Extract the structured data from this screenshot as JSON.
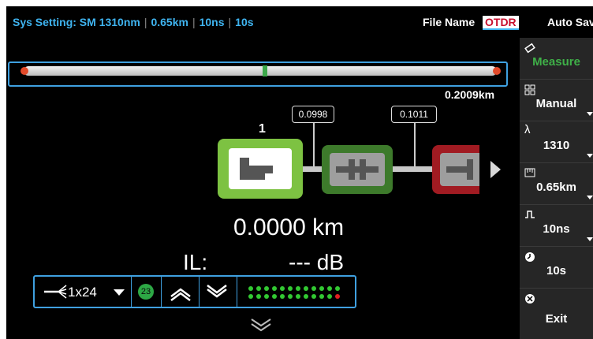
{
  "header": {
    "sys_setting_label": "Sys Setting: SM 1310nm",
    "sys_distance": "0.65km",
    "sys_pulse": "10ns",
    "sys_time": "10s",
    "file_name_label": "File Name",
    "file_name_value": "OTDR",
    "auto_save_label": "Auto Save"
  },
  "trace": {
    "total_distance": "0.2009km",
    "cursor_position_fraction": 0.51
  },
  "event_map": {
    "current_event_number": "1",
    "segments": [
      {
        "loss_label": "0.0998"
      },
      {
        "loss_label": "0.1011"
      }
    ],
    "node_colors": [
      "#7dc242",
      "#3d7a2b",
      "#a11b22"
    ],
    "distance": "0.0000 km",
    "il_label": "IL:",
    "il_value": "--- dB"
  },
  "toolbar": {
    "port_label": "1x24",
    "port_badge": "23",
    "led_count": 24,
    "led_active_color": "#32c832",
    "led_alert_color": "#e02020"
  },
  "sidebar": {
    "items": [
      {
        "label": "Measure",
        "icon": "eraser-icon",
        "active": true
      },
      {
        "label": "Manual",
        "icon": "grid-icon"
      },
      {
        "label": "1310",
        "icon": "lambda-icon"
      },
      {
        "label": "0.65km",
        "icon": "ruler-icon"
      },
      {
        "label": "10ns",
        "icon": "pulse-icon"
      },
      {
        "label": "10s",
        "icon": "clock-icon"
      },
      {
        "label": "Exit",
        "icon": "close-circle-icon"
      }
    ]
  },
  "colors": {
    "accent_blue": "#3fa0e0",
    "active_green": "#3fb048",
    "marker_red": "#e24a2a"
  }
}
